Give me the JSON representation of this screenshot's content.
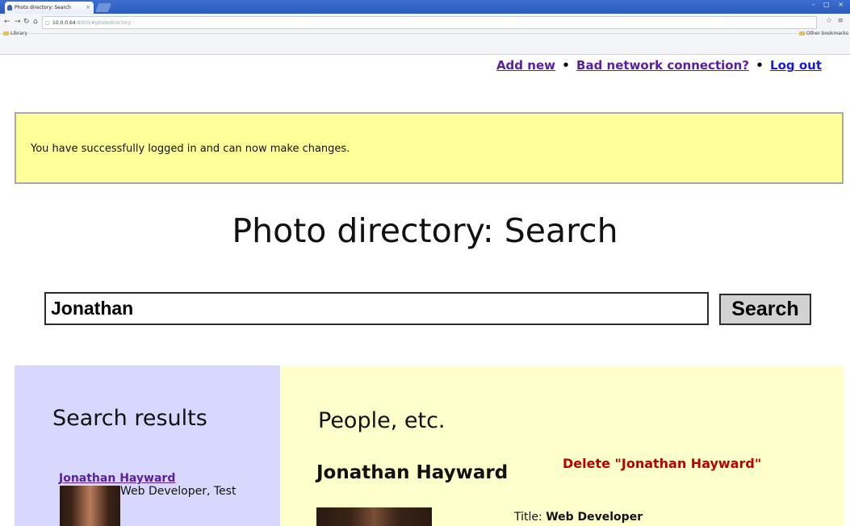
{
  "browser": {
    "tab_title": "Photo directory: Search",
    "tab_close": "×",
    "address_host": "10.0.0.64",
    "address_path": ":8000/#photodirectory",
    "bookmark_left": "Library",
    "bookmark_right": "Other bookmarks",
    "window_buttons": "– □ ×"
  },
  "nav": {
    "add_new": "Add new",
    "bad_network": "Bad network connection?",
    "log_out": "Log out",
    "separator": "•"
  },
  "notification": {
    "message": "You have successfully logged in and can now make changes."
  },
  "page": {
    "title": "Photo directory: Search"
  },
  "search": {
    "value": "Jonathan",
    "button_label": "Search"
  },
  "results": {
    "heading": "Search results",
    "items": [
      {
        "name": "Jonathan Hayward",
        "description": "Web Developer, Test"
      }
    ]
  },
  "people": {
    "heading": "People, etc.",
    "person_name": "Jonathan Hayward",
    "delete_label": "Delete \"Jonathan Hayward\"",
    "title_label": "Title:",
    "title_value": "Web Developer"
  },
  "colors": {
    "notification_bg": "#ffff99",
    "results_bg": "#d8d8ff",
    "people_bg": "#ffffcc",
    "visited_link": "#5a1fa0",
    "link": "#1a1adc",
    "delete": "#b80000"
  }
}
